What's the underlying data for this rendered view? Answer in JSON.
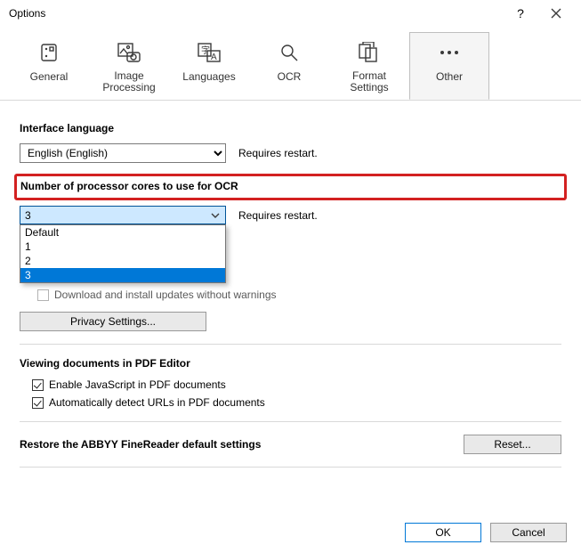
{
  "window": {
    "title": "Options"
  },
  "tabs": {
    "general": "General",
    "image": "Image\nProcessing",
    "languages": "Languages",
    "ocr": "OCR",
    "format": "Format\nSettings",
    "other": "Other"
  },
  "interface_lang": {
    "title": "Interface language",
    "value": "English (English)",
    "note": "Requires restart."
  },
  "cores": {
    "title": "Number of processor cores to use for OCR",
    "value": "3",
    "note": "Requires restart.",
    "options": [
      "Default",
      "1",
      "2",
      "3"
    ]
  },
  "updates_checkbox_label": "Download and install updates without warnings",
  "privacy_btn": "Privacy Settings...",
  "viewing": {
    "title": "Viewing documents in PDF Editor",
    "js": "Enable JavaScript in PDF documents",
    "urls": "Automatically detect URLs in PDF documents"
  },
  "restore": {
    "title": "Restore the ABBYY FineReader default settings",
    "btn": "Reset..."
  },
  "footer": {
    "ok": "OK",
    "cancel": "Cancel"
  }
}
